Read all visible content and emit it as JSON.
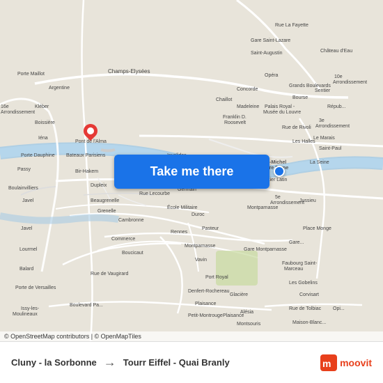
{
  "map": {
    "background_color": "#e8e4da",
    "copyright": "© OpenStreetMap contributors | © OpenMapTiles",
    "take_me_there_label": "Take me there",
    "destination_dot_color": "#1a73e8",
    "origin_pin_color": "#e53935"
  },
  "route": {
    "from": "Cluny - la Sorbonne",
    "arrow": "→",
    "to": "Tourr Eiffel - Quai Branly"
  },
  "branding": {
    "name": "moovit"
  }
}
